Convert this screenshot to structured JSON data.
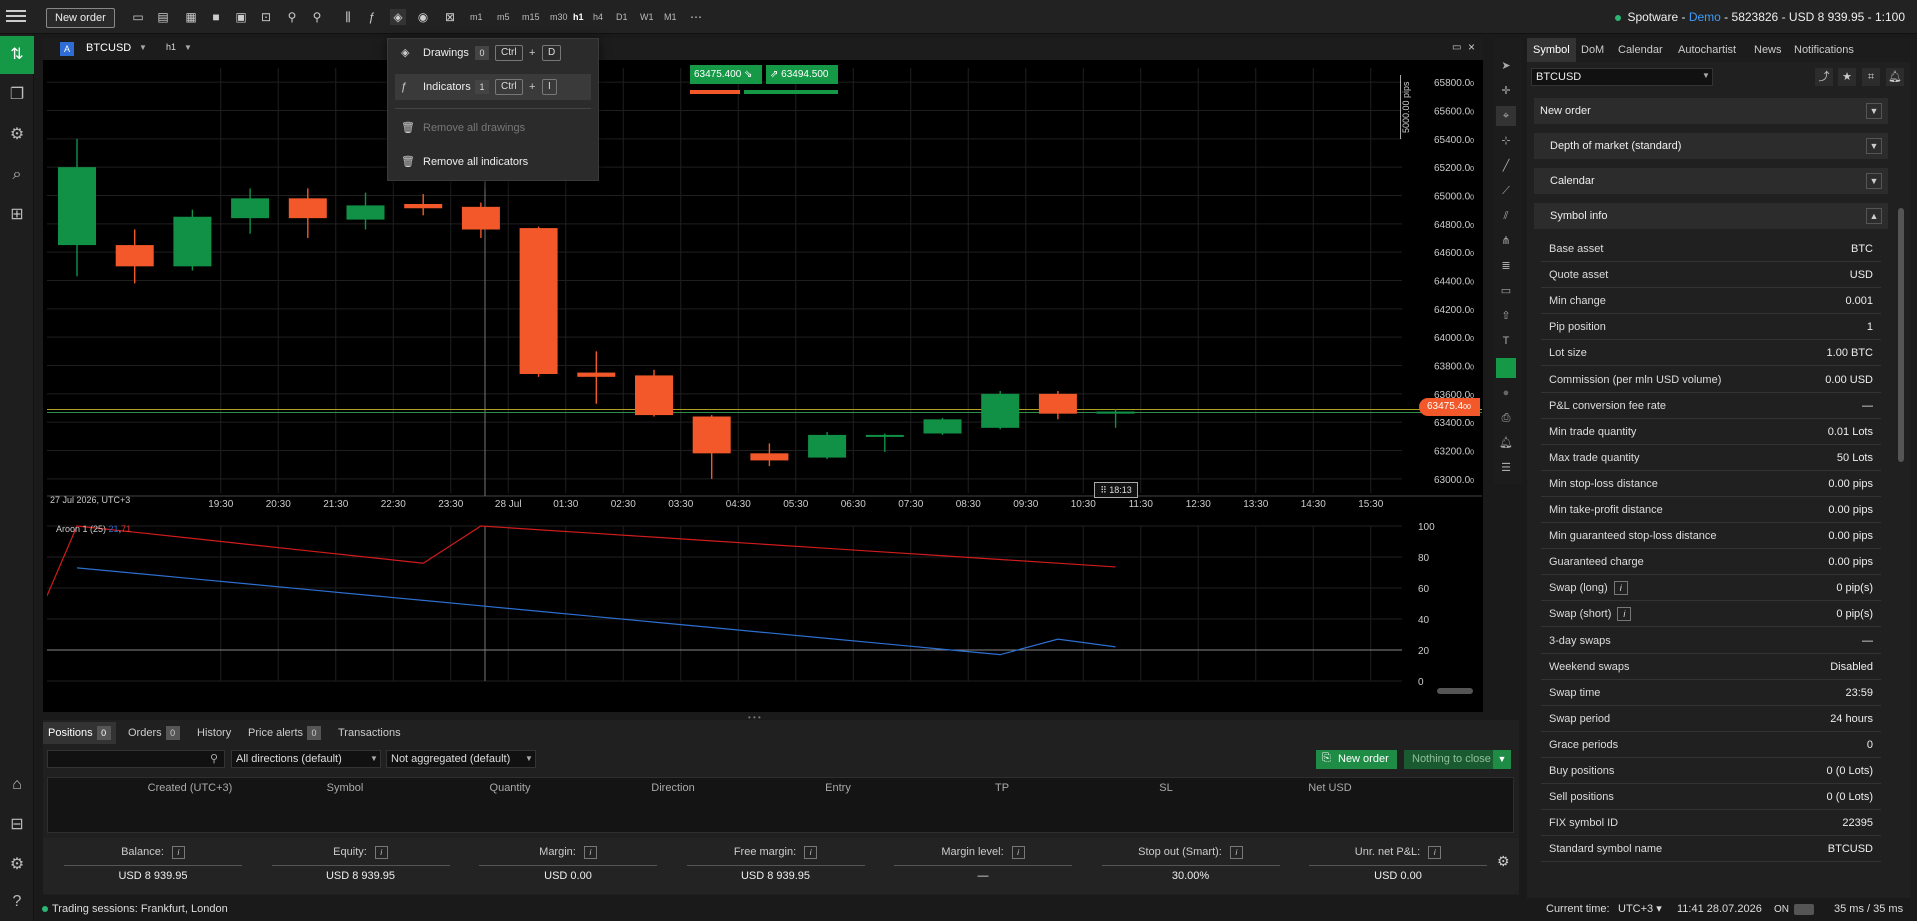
{
  "toolbar": {
    "new_order": "New order",
    "timeframes": [
      "m1",
      "m5",
      "m15",
      "m30",
      "h1",
      "h4",
      "D1",
      "W1",
      "M1"
    ],
    "account": {
      "broker": "Spotware",
      "mode": "Demo",
      "id": "5823826",
      "balance": "USD 8 939.95",
      "leverage": "1:100"
    }
  },
  "chart": {
    "symbol": "BTCUSD",
    "timeframe": "h1",
    "sell_price": "63475.400",
    "buy_price": "63494.500",
    "current_price_tag": "63475.4",
    "current_price_tag_small": "00",
    "countdown": "18:13",
    "pips_label": "5000.00 pips",
    "date_start": "27 Jul 2026, UTC+3",
    "indicator_label": "Aroon 1 (25)",
    "indicator_values": [
      "21",
      "71"
    ]
  },
  "chart_data": {
    "type": "candlestick",
    "y_ticks": [
      "65800.0",
      "65600.0",
      "65400.0",
      "65200.0",
      "65000.0",
      "64800.0",
      "64600.0",
      "64400.0",
      "64200.0",
      "64000.0",
      "63800.0",
      "63600.0",
      "63400.0",
      "63200.0",
      "63000.0"
    ],
    "y_tick_small": "0",
    "x_ticks": [
      "19:30",
      "20:30",
      "21:30",
      "22:30",
      "23:30",
      "28 Jul",
      "01:30",
      "02:30",
      "03:30",
      "04:30",
      "05:30",
      "06:30",
      "07:30",
      "08:30",
      "09:30",
      "10:30",
      "11:30",
      "12:30",
      "13:30",
      "14:30",
      "15:30"
    ],
    "ylim": [
      62900,
      65900
    ],
    "candles": [
      {
        "o": 64650,
        "h": 65400,
        "l": 64430,
        "c": 65200
      },
      {
        "o": 64650,
        "h": 64760,
        "l": 64380,
        "c": 64500
      },
      {
        "o": 64500,
        "h": 64900,
        "l": 64470,
        "c": 64850
      },
      {
        "o": 64840,
        "h": 65050,
        "l": 64730,
        "c": 64980
      },
      {
        "o": 64980,
        "h": 65050,
        "l": 64700,
        "c": 64840
      },
      {
        "o": 64830,
        "h": 65020,
        "l": 64760,
        "c": 64930
      },
      {
        "o": 64940,
        "h": 65010,
        "l": 64860,
        "c": 64910
      },
      {
        "o": 64920,
        "h": 64950,
        "l": 64700,
        "c": 64760
      },
      {
        "o": 64770,
        "h": 64780,
        "l": 63720,
        "c": 63740
      },
      {
        "o": 63750,
        "h": 63900,
        "l": 63530,
        "c": 63720
      },
      {
        "o": 63730,
        "h": 63770,
        "l": 63440,
        "c": 63450
      },
      {
        "o": 63440,
        "h": 63450,
        "l": 63000,
        "c": 63180
      },
      {
        "o": 63180,
        "h": 63250,
        "l": 63090,
        "c": 63130
      },
      {
        "o": 63150,
        "h": 63330,
        "l": 63140,
        "c": 63310
      },
      {
        "o": 63300,
        "h": 63320,
        "l": 63190,
        "c": 63310
      },
      {
        "o": 63320,
        "h": 63430,
        "l": 63310,
        "c": 63420
      },
      {
        "o": 63360,
        "h": 63620,
        "l": 63350,
        "c": 63600
      },
      {
        "o": 63600,
        "h": 63620,
        "l": 63420,
        "c": 63460
      },
      {
        "o": 63460,
        "h": 63490,
        "l": 63360,
        "c": 63475
      }
    ],
    "indicator": {
      "name": "Aroon 1 (25)",
      "y_ticks": [
        "100",
        "80",
        "60",
        "40",
        "20",
        "0"
      ],
      "ylim": [
        0,
        100
      ]
    }
  },
  "dropdown": {
    "drawings": {
      "label": "Drawings",
      "count": "0",
      "key1": "Ctrl",
      "plus": "+",
      "key2": "D"
    },
    "indicators": {
      "label": "Indicators",
      "count": "1",
      "key1": "Ctrl",
      "plus": "+",
      "key2": "I"
    },
    "remove_drawings": "Remove all drawings",
    "remove_indicators": "Remove all indicators"
  },
  "right_panel": {
    "tabs": [
      "Symbol",
      "DoM",
      "Calendar",
      "Autochartist",
      "News",
      "Notifications"
    ],
    "symbol": "BTCUSD",
    "sections": [
      "New order",
      "Depth of market (standard)",
      "Calendar",
      "Symbol info"
    ],
    "info": [
      {
        "k": "Base asset",
        "v": "BTC"
      },
      {
        "k": "Quote asset",
        "v": "USD"
      },
      {
        "k": "Min change",
        "v": "0.001"
      },
      {
        "k": "Pip position",
        "v": "1"
      },
      {
        "k": "Lot size",
        "v": "1.00 BTC"
      },
      {
        "k": "Commission (per mln USD volume)",
        "v": "0.00 USD"
      },
      {
        "k": "P&L conversion fee rate",
        "v": "—"
      },
      {
        "k": "Min trade quantity",
        "v": "0.01 Lots"
      },
      {
        "k": "Max trade quantity",
        "v": "50 Lots"
      },
      {
        "k": "Min stop-loss distance",
        "v": "0.00 pips"
      },
      {
        "k": "Min take-profit distance",
        "v": "0.00 pips"
      },
      {
        "k": "Min guaranteed stop-loss distance",
        "v": "0.00 pips"
      },
      {
        "k": "Guaranteed charge",
        "v": "0.00 pips"
      },
      {
        "k": "Swap (long)",
        "v": "0 pip(s)",
        "info": "i"
      },
      {
        "k": "Swap (short)",
        "v": "0 pip(s)",
        "info": "i"
      },
      {
        "k": "3-day swaps",
        "v": "—"
      },
      {
        "k": "Weekend swaps",
        "v": "Disabled"
      },
      {
        "k": "Swap time",
        "v": "23:59"
      },
      {
        "k": "Swap period",
        "v": "24 hours"
      },
      {
        "k": "Grace periods",
        "v": "0"
      },
      {
        "k": "Buy positions",
        "v": "0  (0 Lots)"
      },
      {
        "k": "Sell positions",
        "v": "0  (0 Lots)"
      },
      {
        "k": "FIX symbol ID",
        "v": "22395"
      },
      {
        "k": "Standard symbol name",
        "v": "BTCUSD"
      }
    ]
  },
  "bottom": {
    "tabs": [
      {
        "label": "Positions",
        "n": "0"
      },
      {
        "label": "Orders",
        "n": "0"
      },
      {
        "label": "History"
      },
      {
        "label": "Price alerts",
        "n": "0"
      },
      {
        "label": "Transactions"
      }
    ],
    "filter_direction": "All directions (default)",
    "filter_aggregation": "Not aggregated (default)",
    "new_order": "New order",
    "nothing_to_close": "Nothing to close",
    "columns": [
      "Created (UTC+3)",
      "Symbol",
      "Quantity",
      "Direction",
      "Entry",
      "TP",
      "SL",
      "Net USD"
    ],
    "summary": [
      {
        "k": "Balance:",
        "v": "USD 8 939.95"
      },
      {
        "k": "Equity:",
        "v": "USD 8 939.95"
      },
      {
        "k": "Margin:",
        "v": "USD 0.00"
      },
      {
        "k": "Free margin:",
        "v": "USD 8 939.95"
      },
      {
        "k": "Margin level:",
        "v": "—"
      },
      {
        "k": "Stop out (Smart):",
        "v": "30.00%"
      },
      {
        "k": "Unr. net P&L:",
        "v": "USD 0.00"
      }
    ],
    "info_glyph": "i"
  },
  "status": {
    "sessions": "Trading sessions: Frankfurt, London",
    "current_time_label": "Current time:",
    "tz": "UTC+3",
    "time": "11:41 28.07.2026",
    "on": "ON",
    "latency": "35 ms / 35 ms"
  },
  "colors": {
    "bull": "#119146",
    "bear": "#f3582a",
    "accent": "#159947",
    "link": "#3d9df5"
  }
}
